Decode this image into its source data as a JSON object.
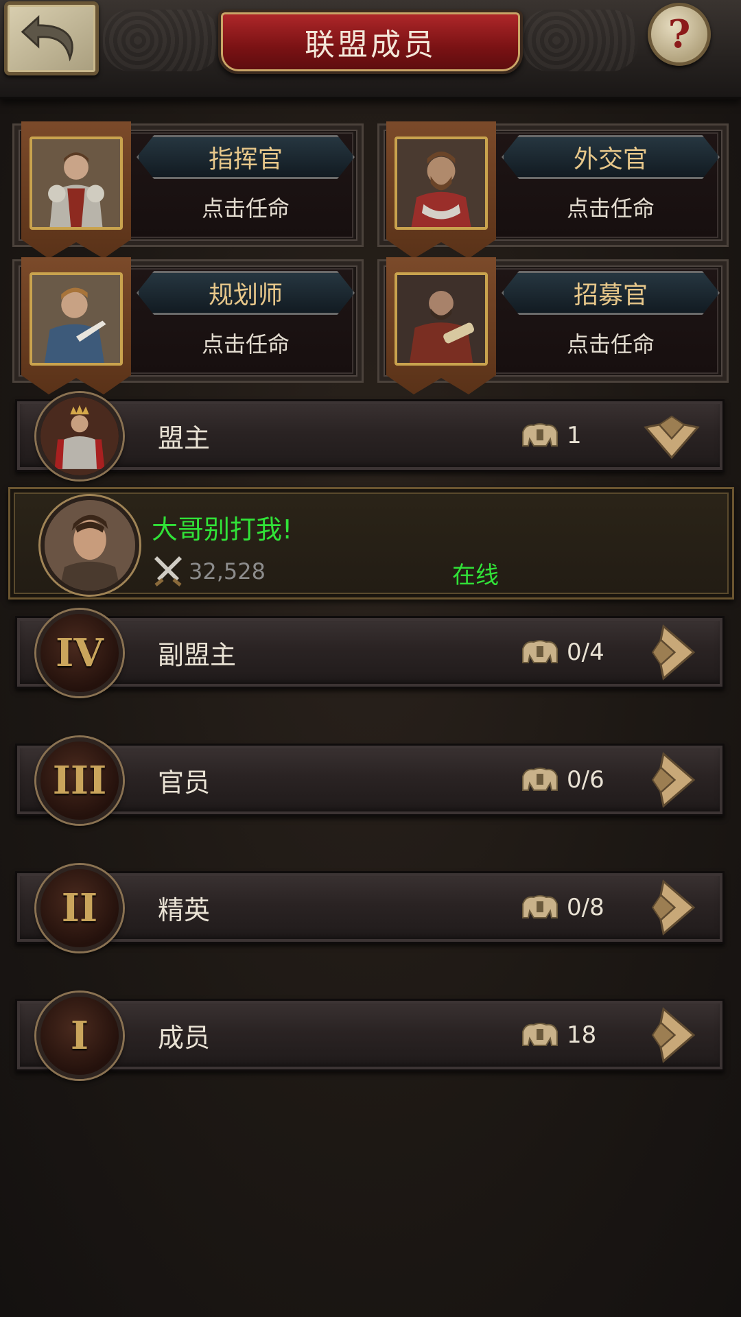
{
  "header": {
    "title": "联盟成员",
    "back_icon": "back-arrow-icon",
    "help_label": "?"
  },
  "officers": [
    {
      "role": "指挥官",
      "action": "点击任命"
    },
    {
      "role": "外交官",
      "action": "点击任命"
    },
    {
      "role": "规划师",
      "action": "点击任命"
    },
    {
      "role": "招募官",
      "action": "点击任命"
    }
  ],
  "ranks": [
    {
      "rank_numeral": "",
      "name": "盟主",
      "count": "1",
      "expanded": true
    },
    {
      "rank_numeral": "IV",
      "name": "副盟主",
      "count": "0/4",
      "expanded": false
    },
    {
      "rank_numeral": "III",
      "name": "官员",
      "count": "0/6",
      "expanded": false
    },
    {
      "rank_numeral": "II",
      "name": "精英",
      "count": "0/8",
      "expanded": false
    },
    {
      "rank_numeral": "I",
      "name": "成员",
      "count": "18",
      "expanded": false
    }
  ],
  "leader_member": {
    "name": "大哥别打我!",
    "power": "32,528",
    "status": "在线"
  },
  "colors": {
    "online_green": "#31e238",
    "title_red": "#9a1c1e",
    "gold": "#caa55c"
  }
}
